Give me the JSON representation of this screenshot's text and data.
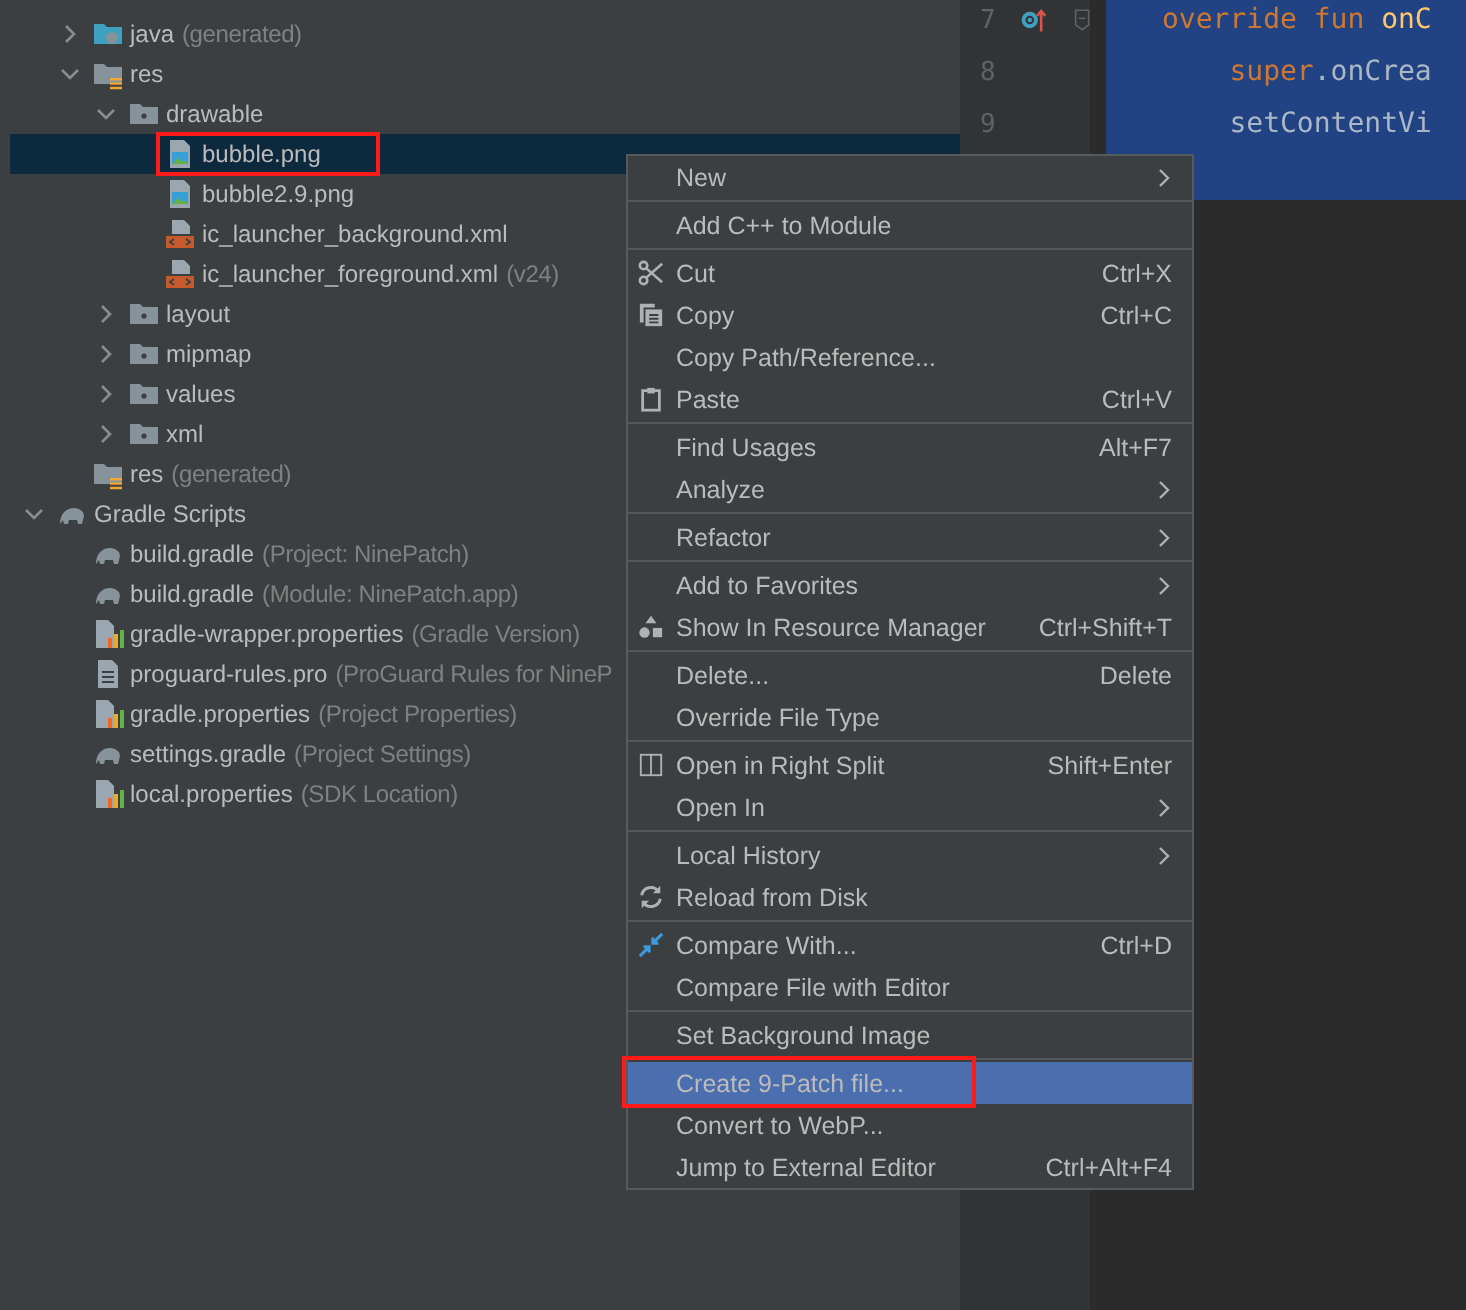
{
  "project_tree": {
    "module_items": [
      {
        "label": "java",
        "note": "(generated)",
        "kind": "java-folder",
        "expanded": false
      },
      {
        "label": "res",
        "kind": "res-folder",
        "expanded": true,
        "children": [
          {
            "label": "drawable",
            "kind": "folder",
            "expanded": true,
            "children": [
              {
                "label": "bubble.png",
                "kind": "image",
                "selected": true,
                "annotated": true
              },
              {
                "label": "bubble2.9.png",
                "kind": "image",
                "selected": false
              },
              {
                "label": "ic_launcher_background.xml",
                "kind": "xml",
                "selected": false
              },
              {
                "label": "ic_launcher_foreground.xml",
                "note": "(v24)",
                "kind": "xml",
                "selected": false
              }
            ]
          },
          {
            "label": "layout",
            "kind": "folder",
            "expanded": false
          },
          {
            "label": "mipmap",
            "kind": "folder",
            "expanded": false
          },
          {
            "label": "values",
            "kind": "folder",
            "expanded": false
          },
          {
            "label": "xml",
            "kind": "folder",
            "expanded": false
          }
        ]
      },
      {
        "label": "res",
        "note": "(generated)",
        "kind": "res-folder",
        "selected": false
      }
    ],
    "gradle_scripts": {
      "label": "Gradle Scripts",
      "kind": "gradle",
      "expanded": true,
      "children": [
        {
          "label": "build.gradle",
          "note": "(Project: NinePatch)",
          "kind": "gradle",
          "selected": false
        },
        {
          "label": "build.gradle",
          "note": "(Module: NinePatch.app)",
          "kind": "gradle",
          "selected": false
        },
        {
          "label": "gradle-wrapper.properties",
          "note": "(Gradle Version)",
          "kind": "properties",
          "selected": false
        },
        {
          "label": "proguard-rules.pro",
          "note": "(ProGuard Rules for NineP",
          "kind": "text",
          "selected": false
        },
        {
          "label": "gradle.properties",
          "note": "(Project Properties)",
          "kind": "properties",
          "selected": false
        },
        {
          "label": "settings.gradle",
          "note": "(Project Settings)",
          "kind": "gradle",
          "selected": false
        },
        {
          "label": "local.properties",
          "note": "(SDK Location)",
          "kind": "properties",
          "selected": false
        }
      ]
    }
  },
  "editor": {
    "lines": [
      {
        "number": "7",
        "tokens": [
          {
            "text": "override fun ",
            "kind": "keyword"
          },
          {
            "text": "onC",
            "kind": "function"
          }
        ]
      },
      {
        "number": "8",
        "tokens": [
          {
            "text": "    super",
            "kind": "keyword"
          },
          {
            "text": ".onCrea",
            "kind": "plain"
          }
        ]
      },
      {
        "number": "9",
        "tokens": [
          {
            "text": "    setContentVi",
            "kind": "plain"
          }
        ]
      }
    ]
  },
  "context_menu": {
    "groups": [
      [
        {
          "label": "New",
          "submenu": true,
          "selected": false
        }
      ],
      [
        {
          "label": "Add C++ to Module",
          "selected": false
        }
      ],
      [
        {
          "label": "Cut",
          "shortcut": "Ctrl+X",
          "kind": "scissors",
          "selected": false
        },
        {
          "label": "Copy",
          "shortcut": "Ctrl+C",
          "kind": "copy",
          "selected": false
        },
        {
          "label": "Copy Path/Reference...",
          "selected": false
        },
        {
          "label": "Paste",
          "shortcut": "Ctrl+V",
          "kind": "clipboard",
          "selected": false
        }
      ],
      [
        {
          "label": "Find Usages",
          "shortcut": "Alt+F7",
          "selected": false
        },
        {
          "label": "Analyze",
          "submenu": true,
          "selected": false
        }
      ],
      [
        {
          "label": "Refactor",
          "submenu": true,
          "selected": false
        }
      ],
      [
        {
          "label": "Add to Favorites",
          "submenu": true,
          "selected": false
        },
        {
          "label": "Show In Resource Manager",
          "shortcut": "Ctrl+Shift+T",
          "kind": "shapes",
          "selected": false
        }
      ],
      [
        {
          "label": "Delete...",
          "shortcut": "Delete",
          "selected": false
        },
        {
          "label": "Override File Type",
          "selected": false
        }
      ],
      [
        {
          "label": "Open in Right Split",
          "shortcut": "Shift+Enter",
          "kind": "split",
          "selected": false
        },
        {
          "label": "Open In",
          "submenu": true,
          "selected": false
        }
      ],
      [
        {
          "label": "Local History",
          "submenu": true,
          "selected": false
        },
        {
          "label": "Reload from Disk",
          "kind": "reload",
          "selected": false
        }
      ],
      [
        {
          "label": "Compare With...",
          "shortcut": "Ctrl+D",
          "kind": "compare",
          "selected": false
        },
        {
          "label": "Compare File with Editor",
          "selected": false
        }
      ],
      [
        {
          "label": "Set Background Image",
          "selected": false
        }
      ],
      [
        {
          "label": "Create 9-Patch file...",
          "selected": true,
          "annotated": true
        },
        {
          "label": "Convert to WebP...",
          "selected": false
        },
        {
          "label": "Jump to External Editor",
          "shortcut": "Ctrl+Alt+F4",
          "selected": false
        }
      ]
    ]
  }
}
